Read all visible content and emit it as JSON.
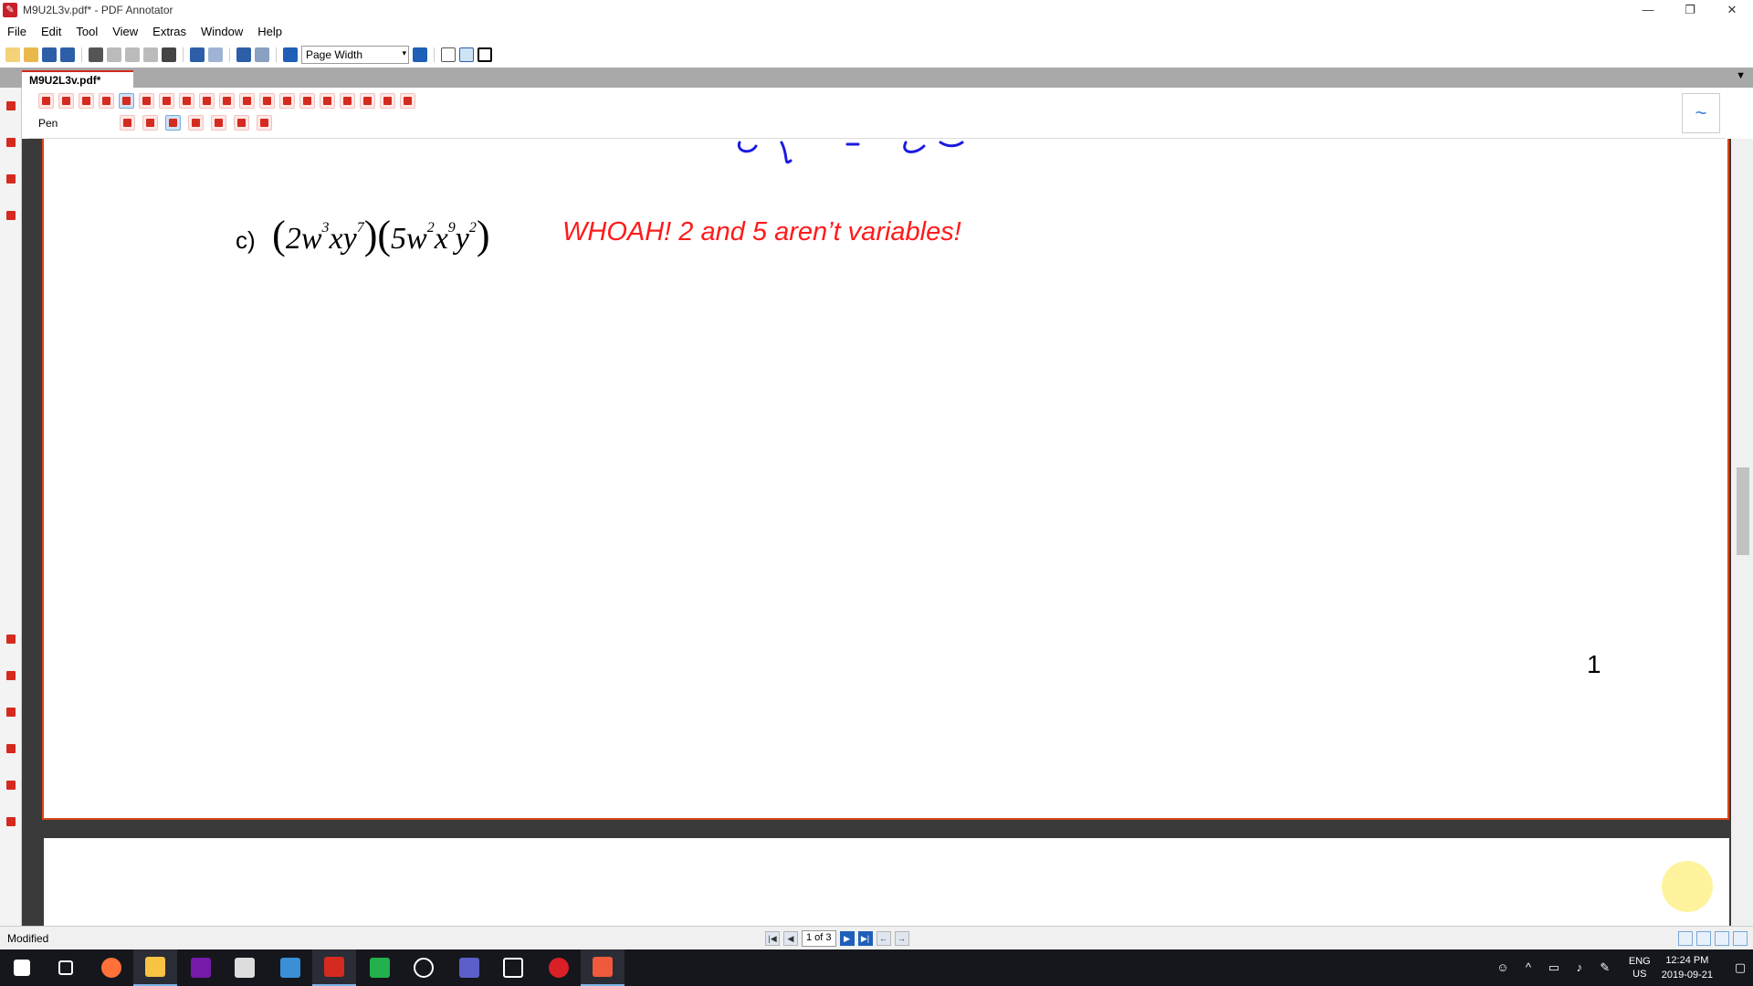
{
  "window": {
    "title": "M9U2L3v.pdf* - PDF Annotator",
    "minimize": "—",
    "restore": "❐",
    "close": "✕"
  },
  "menu": [
    "File",
    "Edit",
    "Tool",
    "View",
    "Extras",
    "Window",
    "Help"
  ],
  "toolbar": {
    "zoom_value": "Page Width"
  },
  "tab": {
    "label": "M9U2L3v.pdf*"
  },
  "annotation_bar": {
    "tool_label": "Pen"
  },
  "document": {
    "problem_label": "c)",
    "expression": {
      "factor1": {
        "coef": "2",
        "terms": [
          {
            "v": "w",
            "e": "3"
          },
          {
            "v": "x",
            "e": ""
          },
          {
            "v": "y",
            "e": "7"
          }
        ]
      },
      "factor2": {
        "coef": "5",
        "terms": [
          {
            "v": "w",
            "e": "2"
          },
          {
            "v": "x",
            "e": "9"
          },
          {
            "v": "y",
            "e": "2"
          }
        ]
      }
    },
    "annotation": "WHOAH! 2 and 5 aren’t variables!",
    "annotation_color": "#ff1a1a",
    "page_number": "1"
  },
  "status": {
    "text": "Modified",
    "page_indicator": "1 of 3"
  },
  "taskbar": {
    "lang": "ENG",
    "region": "US",
    "time": "12:24 PM",
    "date": "2019-09-21",
    "apps": [
      "windows-start-icon",
      "task-view-icon",
      "firefox-icon",
      "file-explorer-icon",
      "onenote-icon",
      "calculator-icon",
      "snipping-icon",
      "pdf-annotator-icon",
      "camtasia-icon",
      "photos-icon",
      "teams-icon",
      "whiteboard-icon",
      "creative-cloud-icon",
      "camtasia-recorder-icon"
    ]
  },
  "colors": {
    "accent": "#d42a1f",
    "page_border": "#d9481c",
    "ink_blue": "#1a1ae0"
  }
}
